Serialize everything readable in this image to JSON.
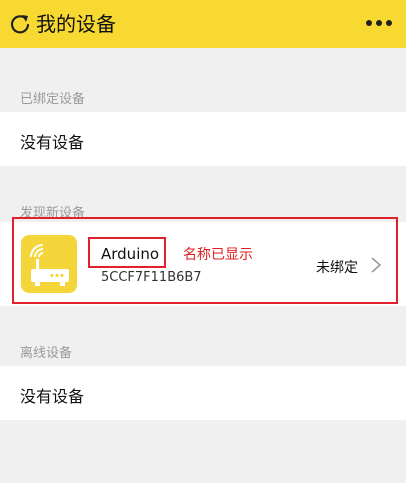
{
  "header": {
    "title": "我的设备",
    "background": "#f8d932",
    "left_icon": "refresh-icon",
    "right_icon": "more-icon"
  },
  "sections": {
    "bound": {
      "label": "已绑定设备",
      "empty_text": "没有设备"
    },
    "discovered": {
      "label": "发现新设备",
      "device": {
        "name": "Arduino",
        "mac": "5CCF7F11B6B7",
        "status": "未绑定",
        "icon": "router-icon",
        "icon_color": "#f5d63a"
      }
    },
    "offline": {
      "label": "离线设备",
      "empty_text": "没有设备"
    }
  },
  "annotation": {
    "text": "名称已显示",
    "color": "#e0202a"
  }
}
